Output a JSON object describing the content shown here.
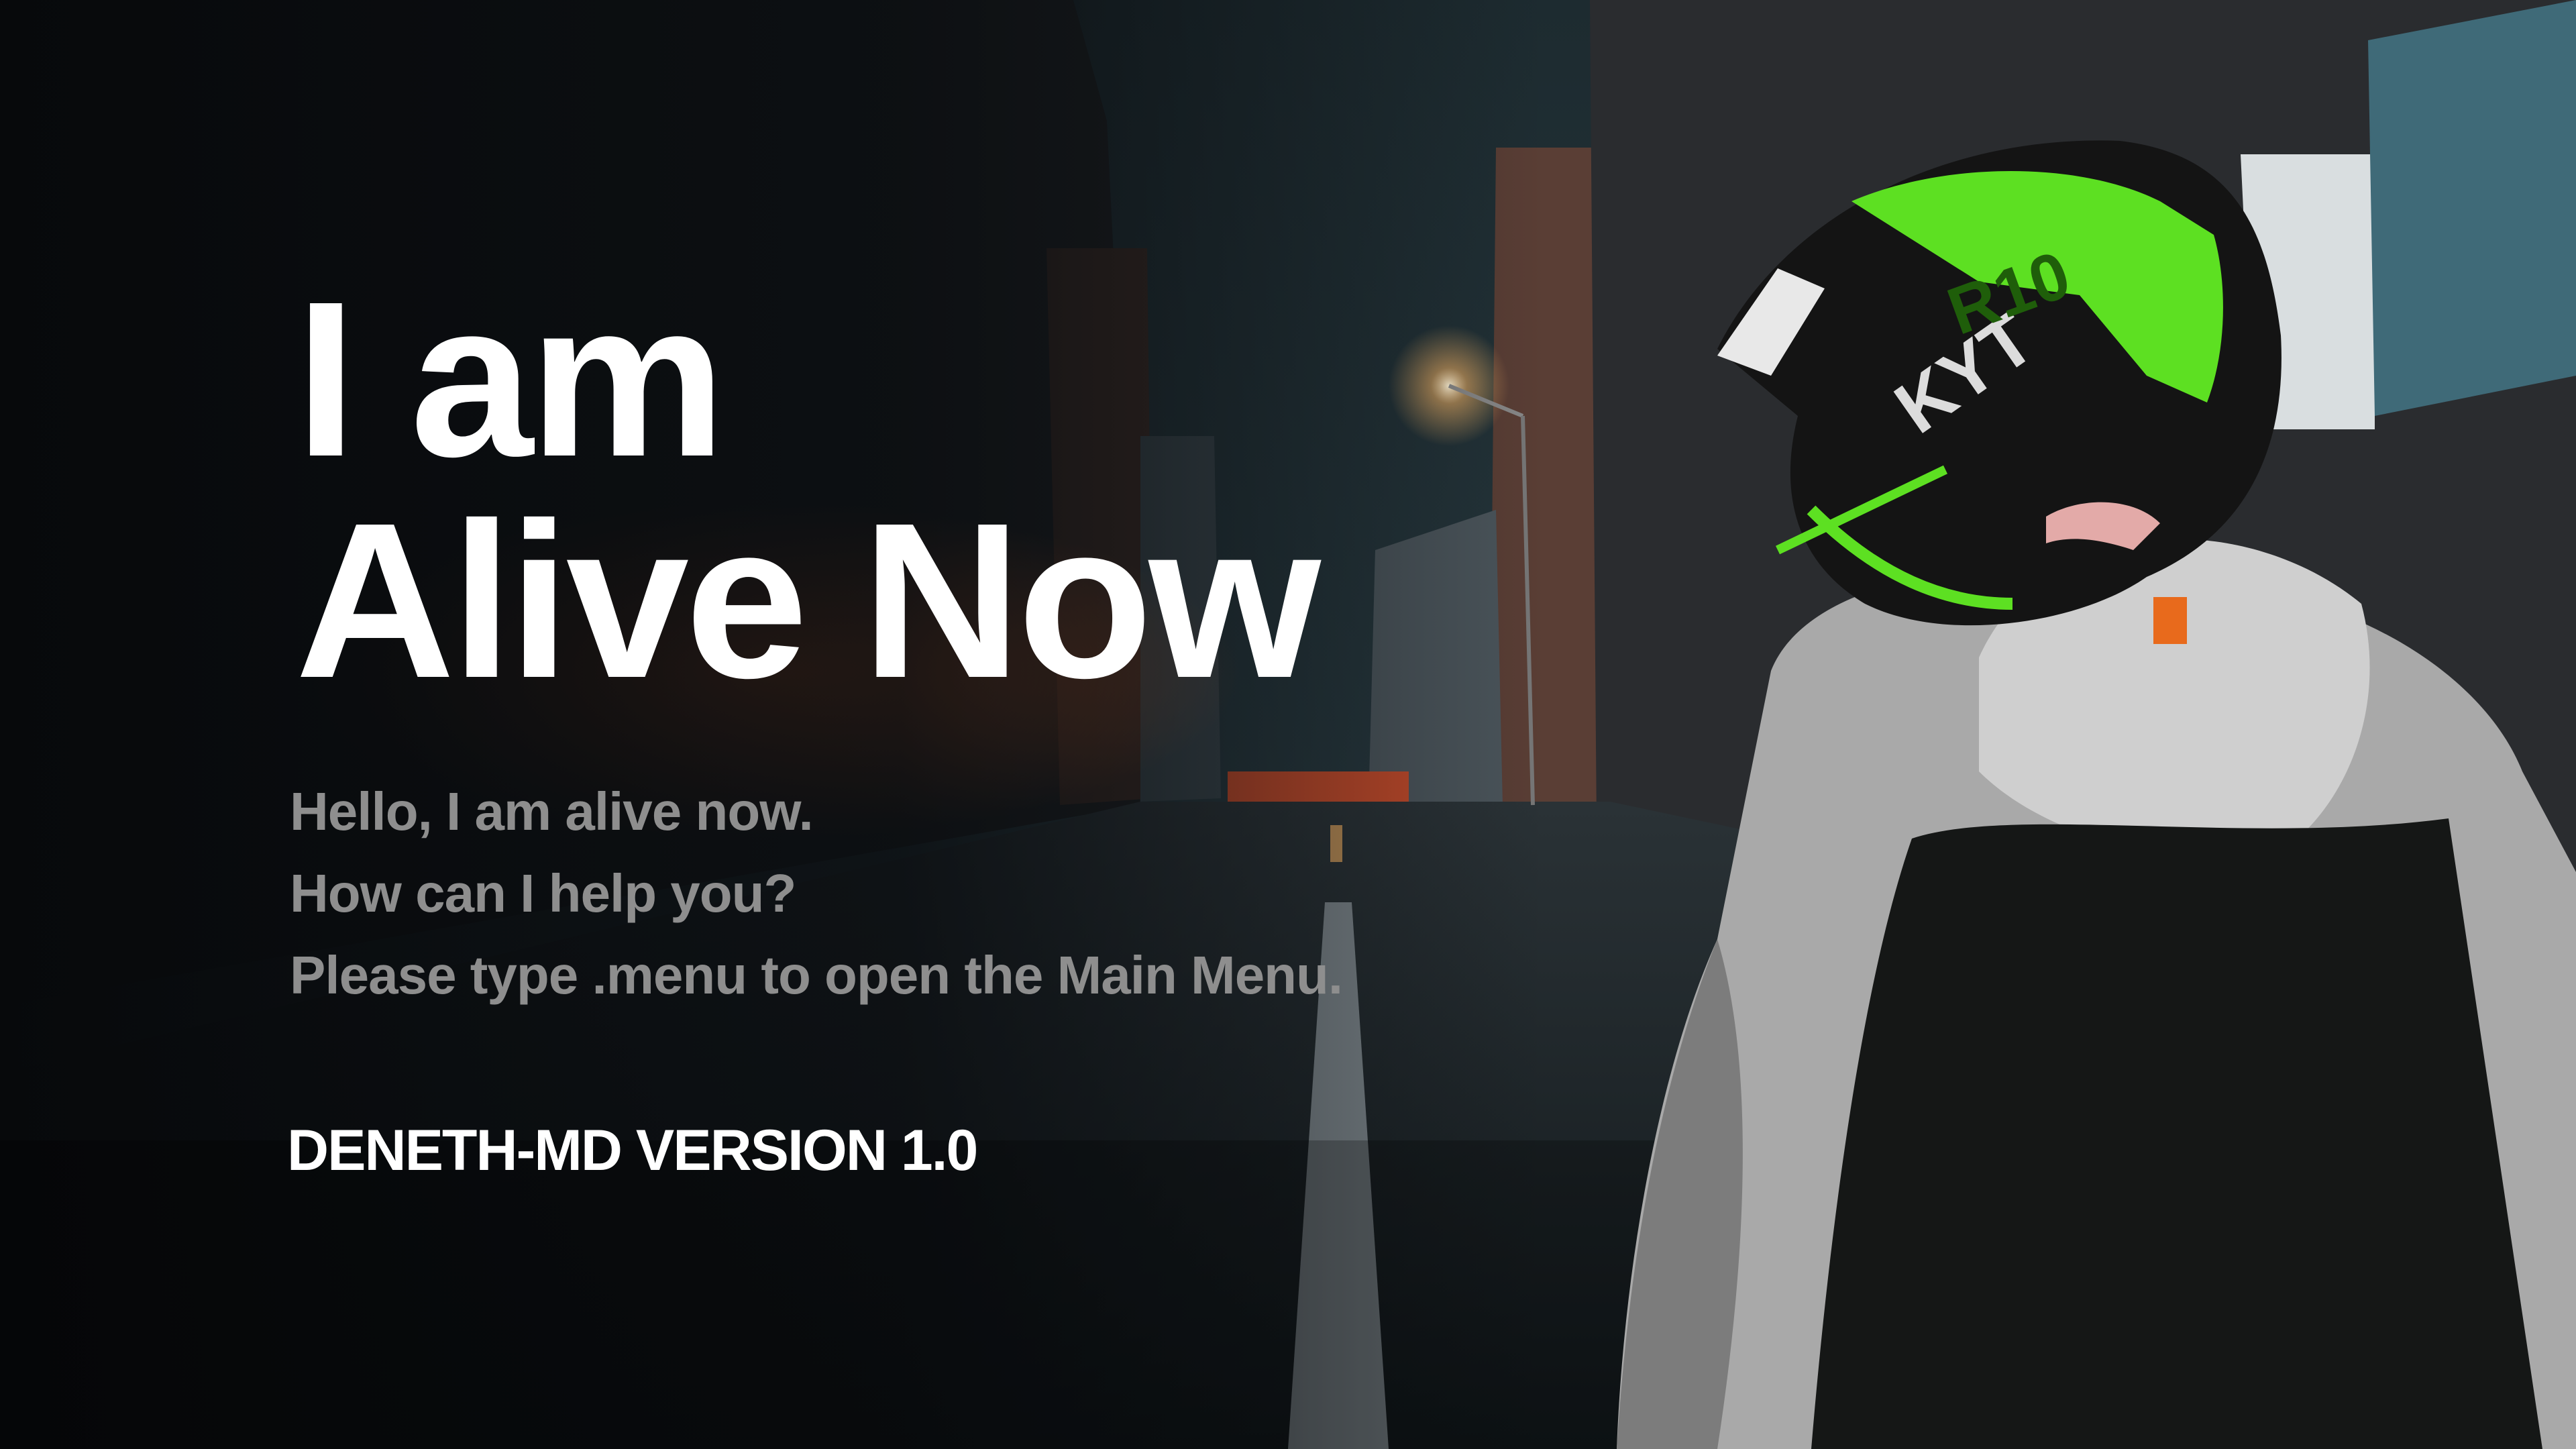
{
  "headline": {
    "line1": "I am",
    "line2": "Alive Now"
  },
  "message": {
    "line1": "Hello, I am alive now.",
    "line2": "How can I help you?",
    "line3": "Please type .menu to open the Main Menu."
  },
  "version_label": "DENETH-MD VERSION 1.0",
  "helmet": {
    "brand_text": "KYT",
    "model_text": "R10"
  },
  "colors": {
    "accent_green": "#5de022",
    "text_gray": "#8e8e8e",
    "text_white": "#ffffff"
  }
}
